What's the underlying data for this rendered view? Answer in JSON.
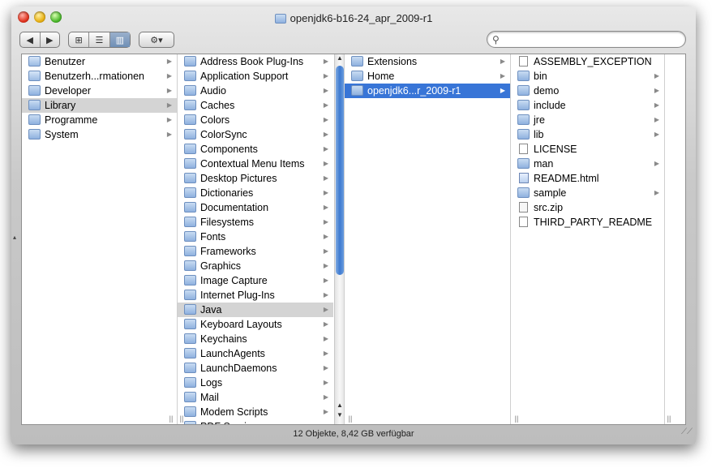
{
  "window": {
    "title": "openjdk6-b16-24_apr_2009-r1",
    "status": "12 Objekte, 8,42 GB verfügbar"
  },
  "toolbar": {
    "back_label": "◀",
    "forward_label": "▶",
    "view_icons_label": "⊞",
    "view_list_label": "☰",
    "view_columns_label": "▥",
    "action_label": "⚙▾",
    "search_placeholder": ""
  },
  "columns": {
    "places": [
      {
        "label": "Benutzer",
        "icon": "home",
        "arrow": true
      },
      {
        "label": "Benutzerh...rmationen",
        "icon": "home",
        "arrow": true
      },
      {
        "label": "Developer",
        "icon": "folder",
        "arrow": true
      },
      {
        "label": "Library",
        "icon": "folder",
        "arrow": true,
        "selected": "inactive"
      },
      {
        "label": "Programme",
        "icon": "folder",
        "arrow": true
      },
      {
        "label": "System",
        "icon": "folder",
        "arrow": true
      }
    ],
    "library": [
      {
        "label": "Address Book Plug-Ins",
        "arrow": true
      },
      {
        "label": "Application Support",
        "arrow": true
      },
      {
        "label": "Audio",
        "arrow": true
      },
      {
        "label": "Caches",
        "arrow": true
      },
      {
        "label": "Colors",
        "arrow": true
      },
      {
        "label": "ColorSync",
        "arrow": true
      },
      {
        "label": "Components",
        "arrow": true
      },
      {
        "label": "Contextual Menu Items",
        "arrow": true
      },
      {
        "label": "Desktop Pictures",
        "arrow": true
      },
      {
        "label": "Dictionaries",
        "arrow": true
      },
      {
        "label": "Documentation",
        "arrow": true
      },
      {
        "label": "Filesystems",
        "arrow": true
      },
      {
        "label": "Fonts",
        "arrow": true
      },
      {
        "label": "Frameworks",
        "arrow": true
      },
      {
        "label": "Graphics",
        "arrow": true
      },
      {
        "label": "Image Capture",
        "arrow": true
      },
      {
        "label": "Internet Plug-Ins",
        "arrow": true
      },
      {
        "label": "Java",
        "arrow": true,
        "selected": "inactive"
      },
      {
        "label": "Keyboard Layouts",
        "arrow": true
      },
      {
        "label": "Keychains",
        "arrow": true
      },
      {
        "label": "LaunchAgents",
        "arrow": true
      },
      {
        "label": "LaunchDaemons",
        "arrow": true
      },
      {
        "label": "Logs",
        "arrow": true
      },
      {
        "label": "Mail",
        "arrow": true
      },
      {
        "label": "Modem Scripts",
        "arrow": true
      },
      {
        "label": "PDF Services",
        "arrow": true
      }
    ],
    "java": [
      {
        "label": "Extensions",
        "arrow": true
      },
      {
        "label": "Home",
        "arrow": true
      },
      {
        "label": "openjdk6...r_2009-r1",
        "arrow": true,
        "selected": "active"
      }
    ],
    "openjdk": [
      {
        "label": "ASSEMBLY_EXCEPTION",
        "icon": "file",
        "arrow": false
      },
      {
        "label": "bin",
        "icon": "folder",
        "arrow": true
      },
      {
        "label": "demo",
        "icon": "folder",
        "arrow": true
      },
      {
        "label": "include",
        "icon": "folder",
        "arrow": true
      },
      {
        "label": "jre",
        "icon": "folder",
        "arrow": true
      },
      {
        "label": "lib",
        "icon": "folder",
        "arrow": true
      },
      {
        "label": "LICENSE",
        "icon": "file",
        "arrow": false
      },
      {
        "label": "man",
        "icon": "folder",
        "arrow": true
      },
      {
        "label": "README.html",
        "icon": "html",
        "arrow": false
      },
      {
        "label": "sample",
        "icon": "folder",
        "arrow": true
      },
      {
        "label": "src.zip",
        "icon": "zip",
        "arrow": false
      },
      {
        "label": "THIRD_PARTY_README",
        "icon": "file",
        "arrow": false
      }
    ]
  },
  "colors": {
    "selection_active": "#3875d7",
    "selection_inactive": "#d4d4d4"
  }
}
